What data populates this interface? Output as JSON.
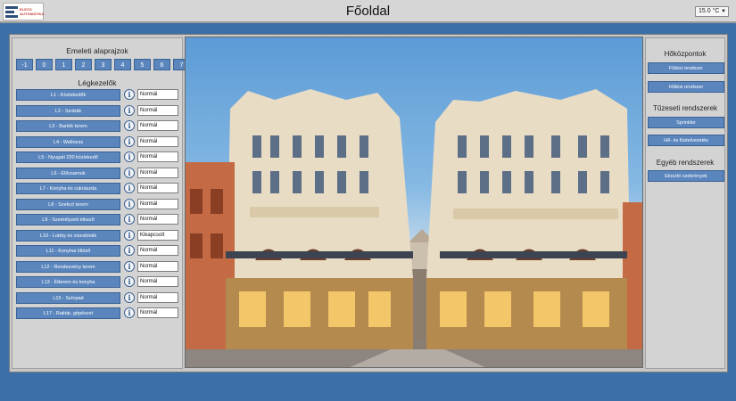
{
  "header": {
    "logo_line1": "ELEZO",
    "logo_line2": "AUTOMATIKA",
    "title": "Főoldal",
    "temperature": "15.0 °C"
  },
  "left_panel": {
    "floor_plans_title": "Emeleti alaprajzok",
    "floor_buttons": [
      "-1",
      "0",
      "1",
      "2",
      "3",
      "4",
      "5",
      "6",
      "7"
    ],
    "ventilation_title": "Légkezelők",
    "units": [
      {
        "label": "L1 - Közlekedők",
        "status": "Normál"
      },
      {
        "label": "L2 - Szobák",
        "status": "Normál"
      },
      {
        "label": "L3 - Bartók terem",
        "status": "Normál"
      },
      {
        "label": "L4 - Wellness",
        "status": "Normál"
      },
      {
        "label": "L5 - Nyugati 230 közlekedő",
        "status": "Normál"
      },
      {
        "label": "L6 - Előcsarnok",
        "status": "Normál"
      },
      {
        "label": "L7 - Konyha és cukrászda",
        "status": "Normál"
      },
      {
        "label": "L8 - Szekcó terem",
        "status": "Normál"
      },
      {
        "label": "L9 - Személyzeti étkező",
        "status": "Normál"
      },
      {
        "label": "L10 - Lobby és vizesblokk",
        "status": "Kikapcsolt"
      },
      {
        "label": "L11 - Konyhai öltöző",
        "status": "Normál"
      },
      {
        "label": "L12 - Rendezvény terem",
        "status": "Normál"
      },
      {
        "label": "L13 - Étterem és konyha",
        "status": "Normál"
      },
      {
        "label": "L15 - Színpad",
        "status": "Normál"
      },
      {
        "label": "L17 - Raktár, gépészet",
        "status": "Normál"
      }
    ]
  },
  "right_panel": {
    "heat_title": "Hőközpontok",
    "heating": "Fűtési rendszer",
    "cooling": "Hűtési rendszer",
    "fire_title": "Tűzeseti rendszerek",
    "sprinkler": "Sprinkler",
    "smoke": "Hő- és füstelvezetés",
    "other_title": "Egyéb rendszerek",
    "elevators": "Elosztó szekrények"
  },
  "colors": {
    "background": "#3c6fa8",
    "button": "#5a86bd",
    "panel": "#d3d3d3"
  }
}
